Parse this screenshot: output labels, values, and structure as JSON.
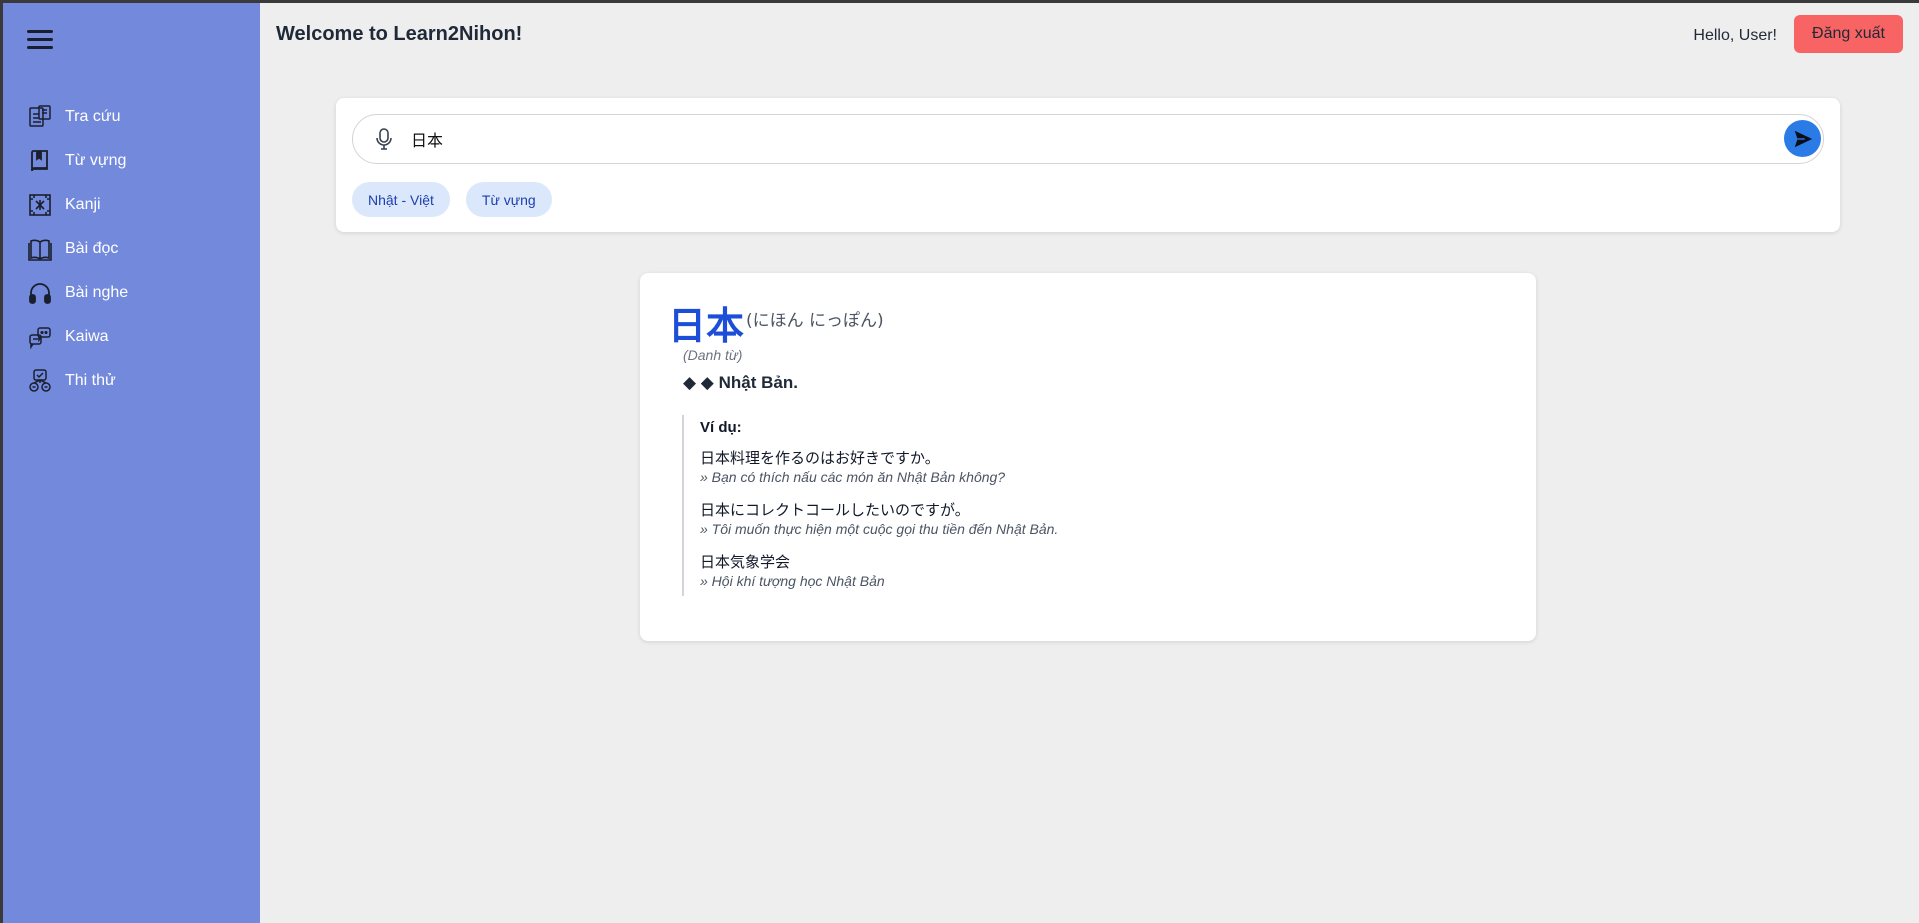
{
  "app": {
    "welcome": "Welcome to Learn2Nihon!",
    "greeting": "Hello, User!",
    "logout_label": "Đăng xuất"
  },
  "sidebar": {
    "items": [
      {
        "label": "Tra cứu",
        "icon": "dictionary-icon"
      },
      {
        "label": "Từ vựng",
        "icon": "book-icon"
      },
      {
        "label": "Kanji",
        "icon": "kanji-icon"
      },
      {
        "label": "Bài đọc",
        "icon": "open-book-icon"
      },
      {
        "label": "Bài nghe",
        "icon": "headphones-icon"
      },
      {
        "label": "Kaiwa",
        "icon": "chat-icon"
      },
      {
        "label": "Thi thử",
        "icon": "quiz-icon"
      }
    ]
  },
  "search": {
    "value": "日本",
    "chips": [
      "Nhật - Việt",
      "Từ vựng"
    ]
  },
  "result": {
    "word": "日本",
    "reading": "(にほん にっぽん)",
    "part_of_speech": "(Danh từ)",
    "meaning": "◆ ◆ Nhật Bản.",
    "examples_title": "Ví dụ:",
    "examples": [
      {
        "jp": "日本料理を作るのはお好きですか。",
        "vi": "» Bạn có thích nấu các món ăn Nhật Bản không?"
      },
      {
        "jp": "日本にコレクトコールしたいのですが。",
        "vi": "» Tôi muốn thực hiện một cuộc gọi thu tiền đến Nhật Bản."
      },
      {
        "jp": "日本気象学会",
        "vi": "» Hội khí tượng học Nhật Bản"
      }
    ]
  },
  "colors": {
    "sidebar": "#7389db",
    "logout": "#f86464",
    "accent": "#1d4ed8",
    "send": "#2b7be6"
  }
}
